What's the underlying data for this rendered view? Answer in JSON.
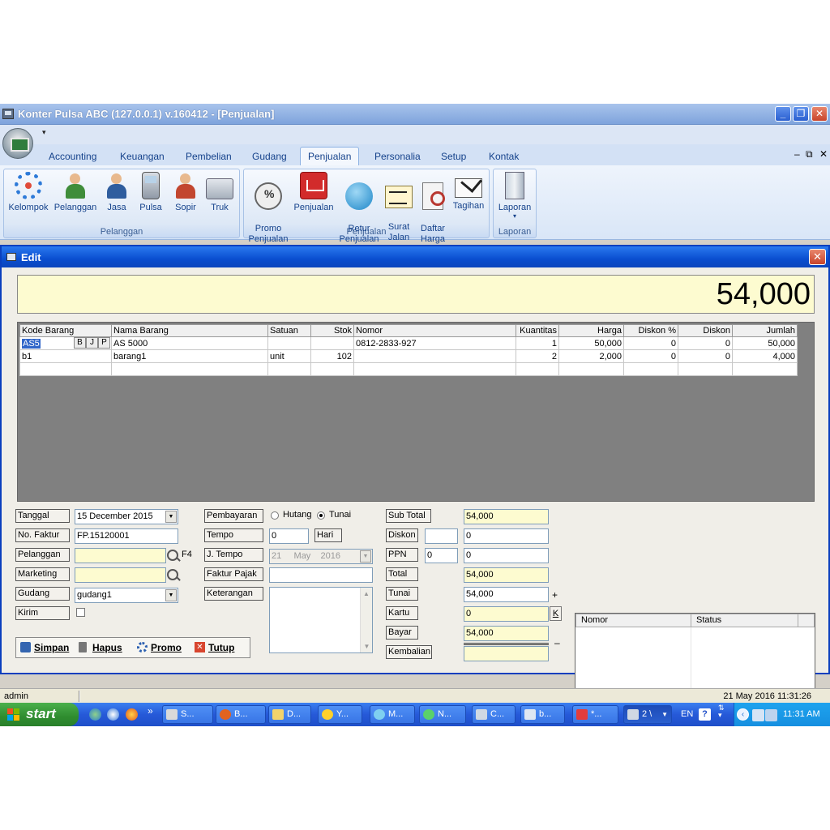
{
  "window": {
    "title": "Konter Pulsa ABC (127.0.0.1) v.160412 - [Penjualan]",
    "minimize": "_",
    "maximize": "❐",
    "close": "✕"
  },
  "ribbon": {
    "tabs": [
      "Accounting",
      "Keuangan",
      "Pembelian",
      "Gudang",
      "Penjualan",
      "Personalia",
      "Setup",
      "Kontak"
    ],
    "active_tab": "Penjualan",
    "mdi_min": "–",
    "mdi_restore": "⧉",
    "mdi_close": "✕",
    "groups": [
      {
        "label": "Pelanggan",
        "buttons": [
          "Kelompok",
          "Pelanggan",
          "Jasa",
          "Pulsa",
          "Sopir",
          "Truk"
        ]
      },
      {
        "label": "Penjualan",
        "buttons": [
          "Promo\nPenjualan",
          "Penjualan",
          "Retur\nPenjualan",
          "Surat\nJalan",
          "Daftar\nHarga",
          "Tagihan"
        ]
      },
      {
        "label": "Laporan",
        "buttons": [
          "Laporan"
        ]
      }
    ]
  },
  "dialog": {
    "title": "Edit",
    "close": "✕",
    "grand_total": "54,000",
    "grid": {
      "columns": [
        "Kode Barang",
        "Nama Barang",
        "Satuan",
        "Stok",
        "Nomor",
        "Kuantitas",
        "Harga",
        "Diskon %",
        "Diskon",
        "Jumlah"
      ],
      "mini_buttons": [
        "B",
        "J",
        "P"
      ],
      "rows": [
        [
          "AS5",
          "AS 5000",
          "",
          "",
          "0812-2833-927",
          "1",
          "50,000",
          "0",
          "0",
          "50,000"
        ],
        [
          "b1",
          "barang1",
          "unit",
          "102",
          "",
          "2",
          "2,000",
          "0",
          "0",
          "4,000"
        ],
        [
          "",
          "",
          "",
          "",
          "",
          "",
          "",
          "",
          "",
          ""
        ]
      ]
    },
    "form": {
      "tanggal_label": "Tanggal",
      "tanggal_value": "15 December 2015",
      "faktur_label": "No. Faktur",
      "faktur_value": "FP.15120001",
      "pelanggan_label": "Pelanggan",
      "pelanggan_value": "",
      "pelanggan_hotkey": "F4",
      "marketing_label": "Marketing",
      "marketing_value": "",
      "gudang_label": "Gudang",
      "gudang_value": "gudang1",
      "kirim_label": "Kirim",
      "pembayaran_label": "Pembayaran",
      "pay_hutang": "Hutang",
      "pay_tunai": "Tunai",
      "pay_selected": "Tunai",
      "tempo_label": "Tempo",
      "tempo_value": "0",
      "tempo_unit": "Hari",
      "jtempo_label": "J. Tempo",
      "jtempo_day": "21",
      "jtempo_month": "May",
      "jtempo_year": "2016",
      "faktur_pajak_label": "Faktur Pajak",
      "faktur_pajak_value": "",
      "keterangan_label": "Keterangan",
      "keterangan_value": "",
      "subtotal_label": "Sub Total",
      "subtotal_value": "54,000",
      "diskon_label": "Diskon",
      "diskon_pct": "",
      "diskon_value": "0",
      "ppn_label": "PPN",
      "ppn_pct": "0",
      "ppn_value": "0",
      "total_label": "Total",
      "total_value": "54,000",
      "tunai_label": "Tunai",
      "tunai_value": "54,000",
      "tunai_sign": "+",
      "kartu_label": "Kartu",
      "kartu_value": "0",
      "kartu_btn": "K",
      "bayar_label": "Bayar",
      "bayar_value": "54,000",
      "kembalian_label": "Kembalian",
      "kembalian_value": "",
      "kembalian_sign": "–"
    },
    "actions": {
      "simpan": "Simpan",
      "hapus": "Hapus",
      "promo": "Promo",
      "tutup": "Tutup"
    },
    "list": {
      "columns": [
        "Nomor",
        "Status"
      ]
    }
  },
  "statusbar": {
    "user": "admin",
    "datetime": "21 May 2016  11:31:26"
  },
  "taskbar": {
    "start": "start",
    "quicklaunch_more": "»",
    "tasks": [
      "S...",
      "B...",
      "D...",
      "Y...",
      "M...",
      "N...",
      "C...",
      "b...",
      "*...",
      "2 \\"
    ],
    "language": "EN",
    "clock": "11:31 AM"
  },
  "colors": {
    "title_blue": "#0a4ecf",
    "total_yellow": "#fdfbd0",
    "grid_gray": "#808080",
    "start_green": "#2f8c2f"
  }
}
